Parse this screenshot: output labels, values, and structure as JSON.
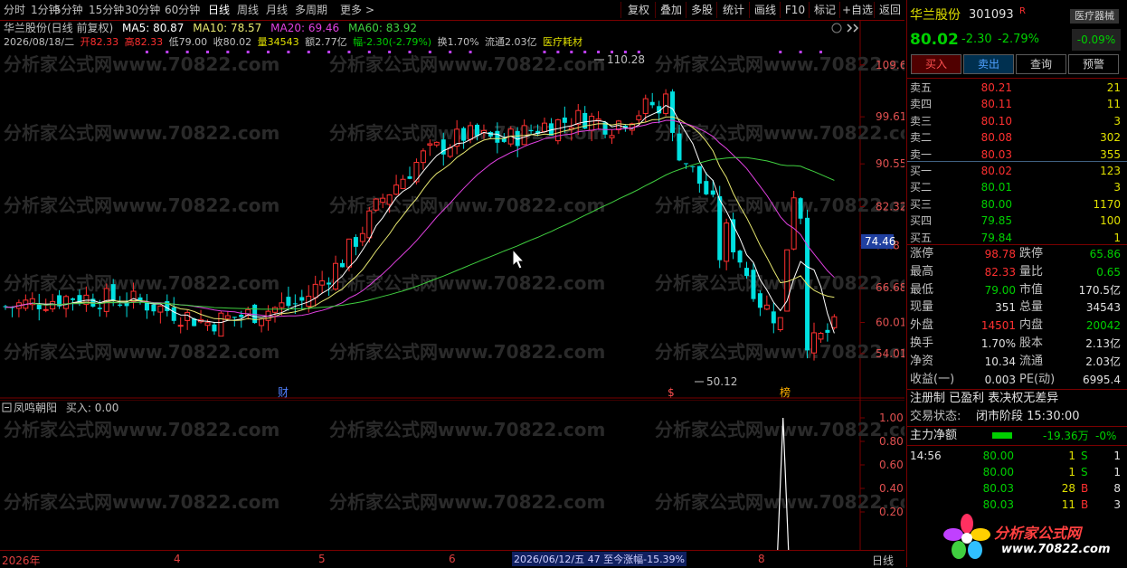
{
  "toolbar": {
    "periods": [
      "分时",
      "1分钟",
      "5分钟",
      "15分钟",
      "30分钟",
      "60分钟",
      "日线",
      "周线",
      "月线",
      "多周期",
      "更多"
    ],
    "active": "日线",
    "more_arrow": ">",
    "tools": [
      "复权",
      "叠加",
      "多股",
      "统计",
      "画线",
      "F10",
      "标记",
      "+自选",
      "返回"
    ]
  },
  "chart_header": {
    "name": "华兰股份(日线 前复权)",
    "ma5": "MA5: 80.87",
    "ma10": "MA10: 78.57",
    "ma20": "MA20: 69.46",
    "ma60": "MA60: 83.92",
    "date": "2026/08/18/二",
    "open": "开82.33",
    "high": "高82.33",
    "low": "低79.00",
    "close": "收80.02",
    "vol": "量34543",
    "amount": "额2.77亿",
    "change": "幅-2.30(-2.79%)",
    "turnover": "换1.70%",
    "float": "流通2.03亿",
    "sector": "医疗耗材"
  },
  "price_axis": [
    "109.6",
    "99.61",
    "90.55",
    "82.32",
    "74.8",
    "66.68",
    "60.01",
    "54.01"
  ],
  "cursor_price": "74.46",
  "annotations": {
    "high": "110.28",
    "low": "50.12",
    "events": [
      "财",
      "$",
      "榜"
    ]
  },
  "indicator": {
    "title": "凤鸣朝阳",
    "value": "买入: 0.00",
    "axis": [
      "1.00",
      "0.80",
      "0.60",
      "0.40",
      "0.20"
    ]
  },
  "date_axis": [
    "2026年",
    "4",
    "5",
    "6",
    "7",
    "8"
  ],
  "range_info": "2026/06/12/五 47 至今涨幅-15.39%",
  "period_label": "日线",
  "watermark": "分析家公式网www.70822.com",
  "logo": {
    "name": "分析家公式网",
    "url": "www.70822.com"
  },
  "quote": {
    "name": "华兰股份",
    "code": "301093",
    "flag": "R",
    "industry": "医疗器械",
    "industry_change": "-0.09%",
    "price": "80.02",
    "change": "-2.30",
    "pct": "-2.79%",
    "buttons": [
      "买入",
      "卖出",
      "查询",
      "预警"
    ],
    "asks": [
      {
        "label": "卖五",
        "price": "80.21",
        "vol": "21"
      },
      {
        "label": "卖四",
        "price": "80.11",
        "vol": "11"
      },
      {
        "label": "卖三",
        "price": "80.10",
        "vol": "3"
      },
      {
        "label": "卖二",
        "price": "80.08",
        "vol": "302"
      },
      {
        "label": "卖一",
        "price": "80.03",
        "vol": "355"
      }
    ],
    "bids": [
      {
        "label": "买一",
        "price": "80.02",
        "vol": "123"
      },
      {
        "label": "买二",
        "price": "80.01",
        "vol": "3"
      },
      {
        "label": "买三",
        "price": "80.00",
        "vol": "1170"
      },
      {
        "label": "买四",
        "price": "79.85",
        "vol": "100"
      },
      {
        "label": "买五",
        "price": "79.84",
        "vol": "1"
      }
    ],
    "stats": [
      {
        "l1": "涨停",
        "v1": "98.78",
        "c1": "red",
        "l2": "跌停",
        "v2": "65.86",
        "c2": "green"
      },
      {
        "l1": "最高",
        "v1": "82.33",
        "c1": "red",
        "l2": "量比",
        "v2": "0.65",
        "c2": "green"
      },
      {
        "l1": "最低",
        "v1": "79.00",
        "c1": "green",
        "l2": "市值",
        "v2": "170.5亿",
        "c2": "white"
      },
      {
        "l1": "现量",
        "v1": "351",
        "c1": "white",
        "l2": "总量",
        "v2": "34543",
        "c2": "white"
      },
      {
        "l1": "外盘",
        "v1": "14501",
        "c1": "red",
        "l2": "内盘",
        "v2": "20042",
        "c2": "green"
      },
      {
        "l1": "换手",
        "v1": "1.70%",
        "c1": "white",
        "l2": "股本",
        "v2": "2.13亿",
        "c2": "white"
      },
      {
        "l1": "净资",
        "v1": "10.34",
        "c1": "white",
        "l2": "流通",
        "v2": "2.03亿",
        "c2": "white"
      },
      {
        "l1": "收益(一)",
        "v1": "0.003",
        "c1": "white",
        "l2": "PE(动)",
        "v2": "6995.4",
        "c2": "white"
      }
    ],
    "reg": "注册制 已盈利 表决权无差异",
    "state_label": "交易状态:",
    "state": "闭市阶段 15:30:00",
    "flow_label": "主力净额",
    "flow_value": "-19.36万",
    "flow_pct": "-0%",
    "ticks": [
      {
        "time": "14:56",
        "price": "80.00",
        "vol": "1",
        "side": "S",
        "n": "1"
      },
      {
        "time": "",
        "price": "80.00",
        "vol": "1",
        "side": "S",
        "n": "1"
      },
      {
        "time": "",
        "price": "80.03",
        "vol": "28",
        "side": "B",
        "n": "8"
      },
      {
        "time": "",
        "price": "80.03",
        "vol": "11",
        "side": "B",
        "n": "3"
      }
    ]
  },
  "colors": {
    "up": "#ff3030",
    "down": "#00e0e0",
    "ma5": "#ffffff",
    "ma10": "#e8e870",
    "ma20": "#e040e0",
    "ma60": "#40d040",
    "grid": "#7a0000"
  }
}
